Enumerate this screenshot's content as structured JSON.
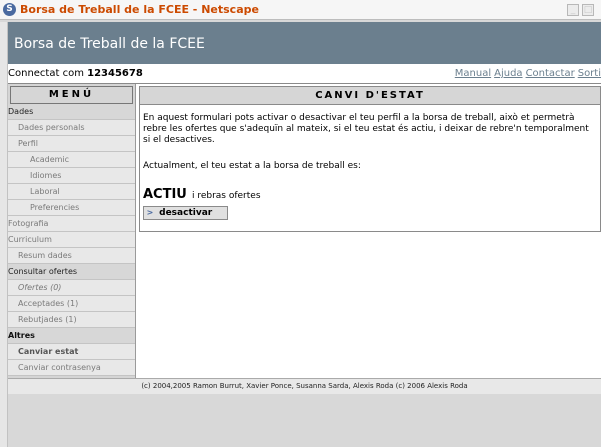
{
  "window": {
    "title": "Borsa de Treball de la FCEE - Netscape"
  },
  "header": {
    "title": "Borsa de Treball de la FCEE"
  },
  "userbar": {
    "connected_prefix": "Connectat com",
    "user_id": "12345678",
    "links": [
      "Manual",
      "Ajuda",
      "Contactar",
      "Sorti"
    ]
  },
  "menu": {
    "title": "MENÚ",
    "items": [
      {
        "label": "Dades",
        "level": "sec"
      },
      {
        "label": "Dades personals",
        "level": "l1"
      },
      {
        "label": "Perfil",
        "level": "l1"
      },
      {
        "label": "Academic",
        "level": "l2"
      },
      {
        "label": "Idiomes",
        "level": "l2"
      },
      {
        "label": "Laboral",
        "level": "l2"
      },
      {
        "label": "Preferencies",
        "level": "l2"
      },
      {
        "label": "Fotografia",
        "level": "i1"
      },
      {
        "label": "Curriculum",
        "level": "i1"
      },
      {
        "label": "Resum dades",
        "level": "l1"
      },
      {
        "label": "Consultar ofertes",
        "level": "sec"
      },
      {
        "label": "Ofertes (0)",
        "level": "l1"
      },
      {
        "label": "Acceptades (1)",
        "level": "l1"
      },
      {
        "label": "Rebutjades (1)",
        "level": "l1"
      },
      {
        "label": "Altres",
        "level": "sec"
      },
      {
        "label": "Canviar estat",
        "level": "l1"
      },
      {
        "label": "Canviar contrasenya",
        "level": "l1"
      }
    ]
  },
  "content": {
    "title": "CANVI D'ESTAT",
    "intro": "En aquest formulari pots activar o desactivar el teu perfil a la borsa de treball, això et permetrà rebre les ofertes que s'adequïn al mateix, si el teu estat és actiu, i deixar de rebre'n temporalment si el desactives.",
    "current_label": "Actualment, el teu estat a la borsa de treball es:",
    "status": "ACTIU",
    "status_suffix": "i rebras ofertes",
    "button_label": "desactivar"
  },
  "footer": {
    "text": "(c) 2004,2005 Ramon Burrut, Xavier Ponce, Susanna Sarda, Alexis Roda (c) 2006 Alexis Roda"
  }
}
